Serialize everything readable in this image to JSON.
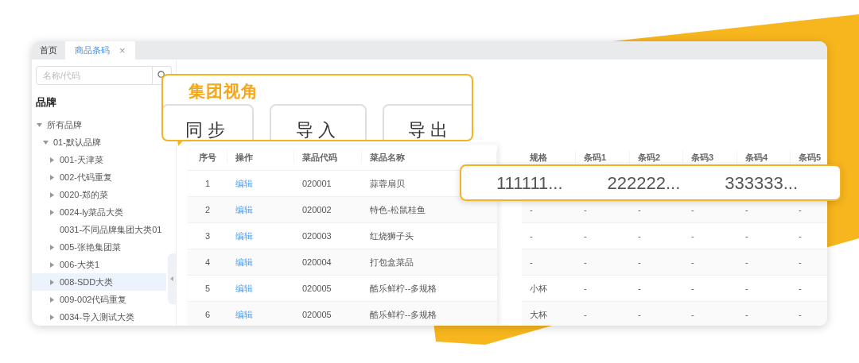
{
  "tabs": [
    {
      "label": "首页",
      "selected": false
    },
    {
      "label": "商品条码",
      "selected": true,
      "close_icon": "×"
    }
  ],
  "sidebar": {
    "search": {
      "placeholder": "名称/代码"
    },
    "title": "品牌",
    "tree": [
      {
        "label": "所有品牌",
        "expandable": true,
        "expanded": true,
        "selected": false,
        "children": [
          {
            "label": "01-默认品牌",
            "expandable": true,
            "expanded": true,
            "selected": false,
            "children": [
              {
                "label": "001-天津菜",
                "expandable": true,
                "expanded": false,
                "selected": false
              },
              {
                "label": "002-代码重复",
                "expandable": true,
                "expanded": false,
                "selected": false
              },
              {
                "label": "0020-郑的菜",
                "expandable": true,
                "expanded": false,
                "selected": false
              },
              {
                "label": "0024-ly菜品大类",
                "expandable": true,
                "expanded": false,
                "selected": false
              },
              {
                "label": "0031-不同品牌集团大类01",
                "expandable": false,
                "expanded": false,
                "selected": false
              },
              {
                "label": "005-张艳集团菜",
                "expandable": true,
                "expanded": false,
                "selected": false
              },
              {
                "label": "006-大类1",
                "expandable": true,
                "expanded": false,
                "selected": false
              },
              {
                "label": "008-SDD大类",
                "expandable": true,
                "expanded": false,
                "selected": true
              },
              {
                "label": "009-002代码重复",
                "expandable": true,
                "expanded": false,
                "selected": false
              },
              {
                "label": "0034-导入测试大类",
                "expandable": true,
                "expanded": false,
                "selected": false
              }
            ]
          }
        ]
      }
    ]
  },
  "table": {
    "left_columns": [
      "序号",
      "操作",
      "菜品代码",
      "菜品名称"
    ],
    "right_columns": [
      "规格",
      "条码1",
      "条码2",
      "条码3",
      "条码4",
      "条码5"
    ],
    "rows": [
      {
        "index": "1",
        "action": "编辑",
        "code": "020001",
        "name": "蒜蓉扇贝"
      },
      {
        "index": "2",
        "action": "编辑",
        "code": "020002",
        "name": "特色-松鼠桂鱼",
        "spec": "-",
        "barcodes": [
          "-",
          "-",
          "-",
          "-",
          "-"
        ]
      },
      {
        "index": "3",
        "action": "编辑",
        "code": "020003",
        "name": "红烧狮子头",
        "spec": "-",
        "barcodes": [
          "-",
          "-",
          "-",
          "-",
          "-"
        ]
      },
      {
        "index": "4",
        "action": "编辑",
        "code": "020004",
        "name": "打包盒菜品",
        "spec": "-",
        "barcodes": [
          "-",
          "-",
          "-",
          "-",
          "-"
        ]
      },
      {
        "index": "5",
        "action": "编辑",
        "code": "020005",
        "name": "酷乐鲜柠--多规格",
        "spec": "小杯",
        "barcodes": [
          "-",
          "-",
          "-",
          "-",
          "-"
        ]
      },
      {
        "index": "6",
        "action": "编辑",
        "code": "020005",
        "name": "酷乐鲜柠--多规格",
        "spec": "大杯",
        "barcodes": [
          "-",
          "-",
          "-",
          "-",
          "-"
        ]
      }
    ]
  },
  "callouts": [
    {
      "title": "集团视角",
      "buttons": [
        "同步",
        "导入",
        "导出"
      ]
    },
    {
      "values": [
        "111111...",
        "222222...",
        "333333..."
      ]
    }
  ]
}
